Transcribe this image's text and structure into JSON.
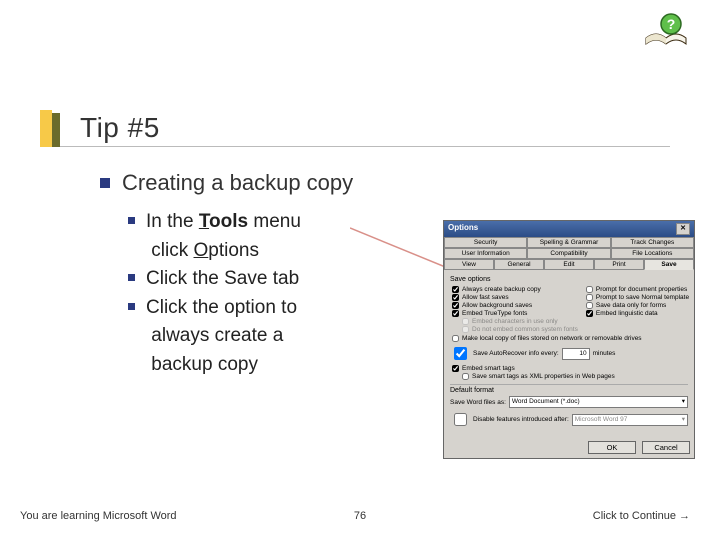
{
  "help_icon_char": "?",
  "title": "Tip #5",
  "main_bullet": "Creating a backup copy",
  "sub_items": {
    "a1": "In the ",
    "a_bold_under": "T",
    "a_bold_rest": "ools",
    "a2": " menu",
    "a_wrap_pre": "click ",
    "a_wrap_under": "O",
    "a_wrap_rest": "ptions",
    "b": "Click the Save tab",
    "c1": "Click the option to",
    "c2": "always create a",
    "c3": "backup copy"
  },
  "dialog": {
    "title": "Options",
    "close": "✕",
    "tabs_row1": [
      "Security",
      "Spelling & Grammar",
      "Track Changes"
    ],
    "tabs_row2": [
      "User Information",
      "Compatibility",
      "File Locations"
    ],
    "tabs_row3": [
      "View",
      "General",
      "Edit",
      "Print",
      "Save"
    ],
    "save_options_label": "Save options",
    "left_opts": [
      {
        "label": "Always create backup copy",
        "checked": true
      },
      {
        "label": "Allow fast saves",
        "checked": true
      },
      {
        "label": "Allow background saves",
        "checked": true
      },
      {
        "label": "Embed TrueType fonts",
        "checked": true
      }
    ],
    "right_opts": [
      {
        "label": "Prompt for document properties",
        "checked": false
      },
      {
        "label": "Prompt to save Normal template",
        "checked": false
      },
      {
        "label": "Save data only for forms",
        "checked": false
      },
      {
        "label": "Embed linguistic data",
        "checked": true
      }
    ],
    "sub_opts": [
      {
        "label": "Embed characters in use only",
        "checked": false,
        "disabled": true
      },
      {
        "label": "Do not embed common system fonts",
        "checked": false,
        "disabled": true
      }
    ],
    "net_opt": {
      "label": "Make local copy of files stored on network or removable drives",
      "checked": false
    },
    "autorecover": {
      "label": "Save AutoRecover info every:",
      "checked": true,
      "value": "10",
      "unit": "minutes"
    },
    "smarttags": {
      "label": "Embed smart tags",
      "checked": true
    },
    "smarttags_xml": {
      "label": "Save smart tags as XML properties in Web pages",
      "checked": false
    },
    "default_format_label": "Default format",
    "save_as_label": "Save Word files as:",
    "save_as_value": "Word Document (*.doc)",
    "disable_after": {
      "label": "Disable features introduced after:",
      "checked": false,
      "value": "Microsoft Word 97"
    },
    "ok": "OK",
    "cancel": "Cancel"
  },
  "footer": {
    "left": "You are learning Microsoft Word",
    "center": "76",
    "right": "Click to Continue →"
  }
}
